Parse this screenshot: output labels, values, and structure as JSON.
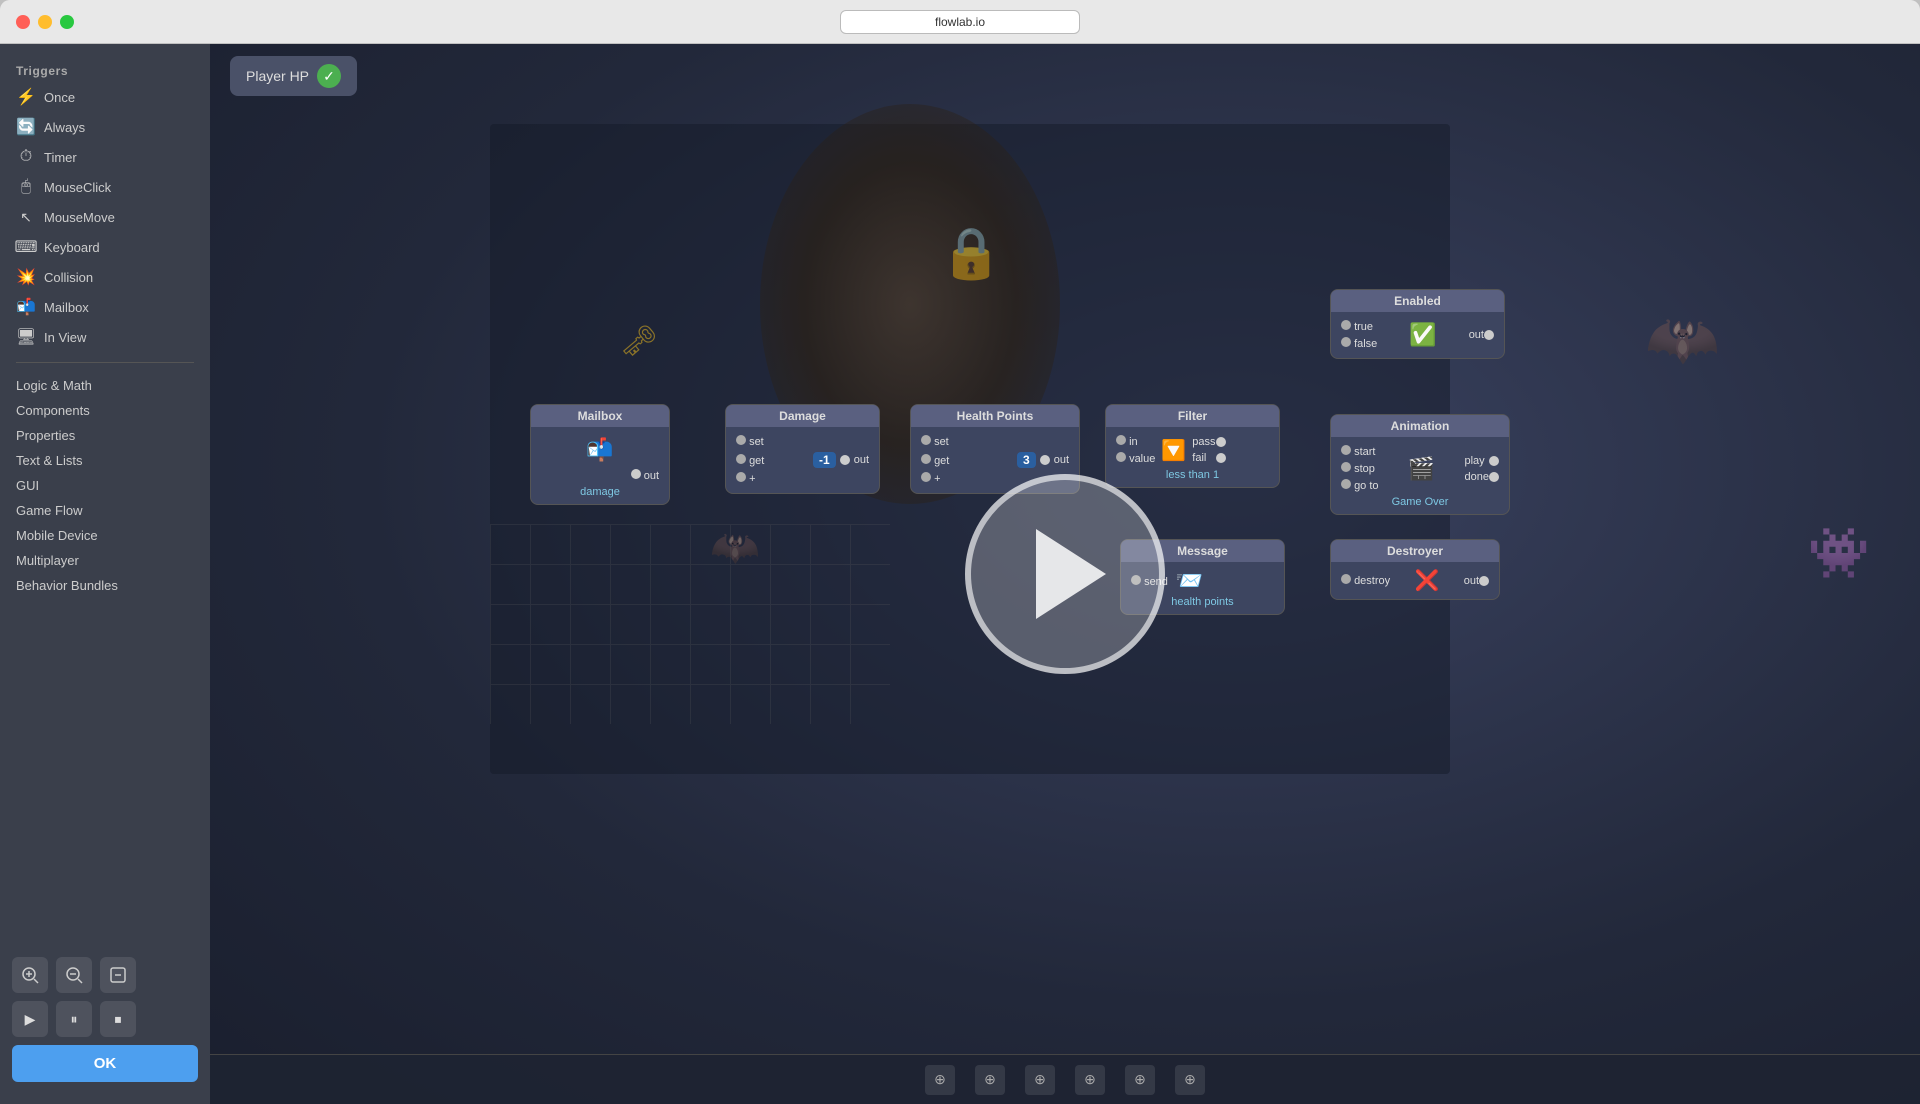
{
  "window": {
    "title": "flowlab.io",
    "url": "flowlab.io"
  },
  "sidebar": {
    "section_triggers": "Triggers",
    "triggers": [
      {
        "id": "once",
        "label": "Once",
        "icon": "⚡"
      },
      {
        "id": "always",
        "label": "Always",
        "icon": "🔄"
      },
      {
        "id": "timer",
        "label": "Timer",
        "icon": "⏱"
      },
      {
        "id": "mouseclick",
        "label": "MouseClick",
        "icon": "🖱"
      },
      {
        "id": "mousemove",
        "label": "MouseMove",
        "icon": "↖"
      },
      {
        "id": "keyboard",
        "label": "Keyboard",
        "icon": "⌨"
      },
      {
        "id": "collision",
        "label": "Collision",
        "icon": "💥"
      },
      {
        "id": "mailbox",
        "label": "Mailbox",
        "icon": "📬"
      },
      {
        "id": "inview",
        "label": "In View",
        "icon": "🖥"
      }
    ],
    "categories": [
      "Logic & Math",
      "Components",
      "Properties",
      "Text & Lists",
      "GUI",
      "Game Flow",
      "Mobile Device",
      "Multiplayer",
      "Behavior Bundles"
    ],
    "ok_label": "OK"
  },
  "canvas": {
    "header": {
      "title": "Player HP",
      "check": "✓"
    },
    "nodes": {
      "mailbox": {
        "label": "Mailbox",
        "sublabel": "damage",
        "port_out": "out"
      },
      "damage": {
        "label": "Damage",
        "port_set": "set",
        "port_get": "get",
        "port_plus": "+",
        "value": "-1",
        "port_out": "out"
      },
      "health_points": {
        "label": "Health Points",
        "port_set": "set",
        "port_get": "get",
        "port_plus": "+",
        "value": "3",
        "port_out": "out"
      },
      "filter": {
        "label": "Filter",
        "port_in": "in",
        "port_value": "value",
        "port_pass": "pass",
        "port_fail": "fail",
        "sublabel": "less than 1"
      },
      "enabled": {
        "label": "Enabled",
        "port_true": "true",
        "port_false": "false",
        "port_out": "out"
      },
      "animation": {
        "label": "Animation",
        "port_start": "start",
        "port_stop": "stop",
        "port_goto": "go to",
        "port_play": "play",
        "port_done": "done",
        "sublabel": "Game Over"
      },
      "message": {
        "label": "Message",
        "port_send": "send",
        "sublabel": "health points"
      },
      "destroyer": {
        "label": "Destroyer",
        "port_destroy": "destroy",
        "port_out": "out"
      }
    },
    "play_button": "▶"
  },
  "icons": {
    "zoom_in": "🔍",
    "zoom_out": "🔍",
    "reset": "⊙",
    "play": "▶",
    "pause": "⏸",
    "stop": "⏹"
  }
}
